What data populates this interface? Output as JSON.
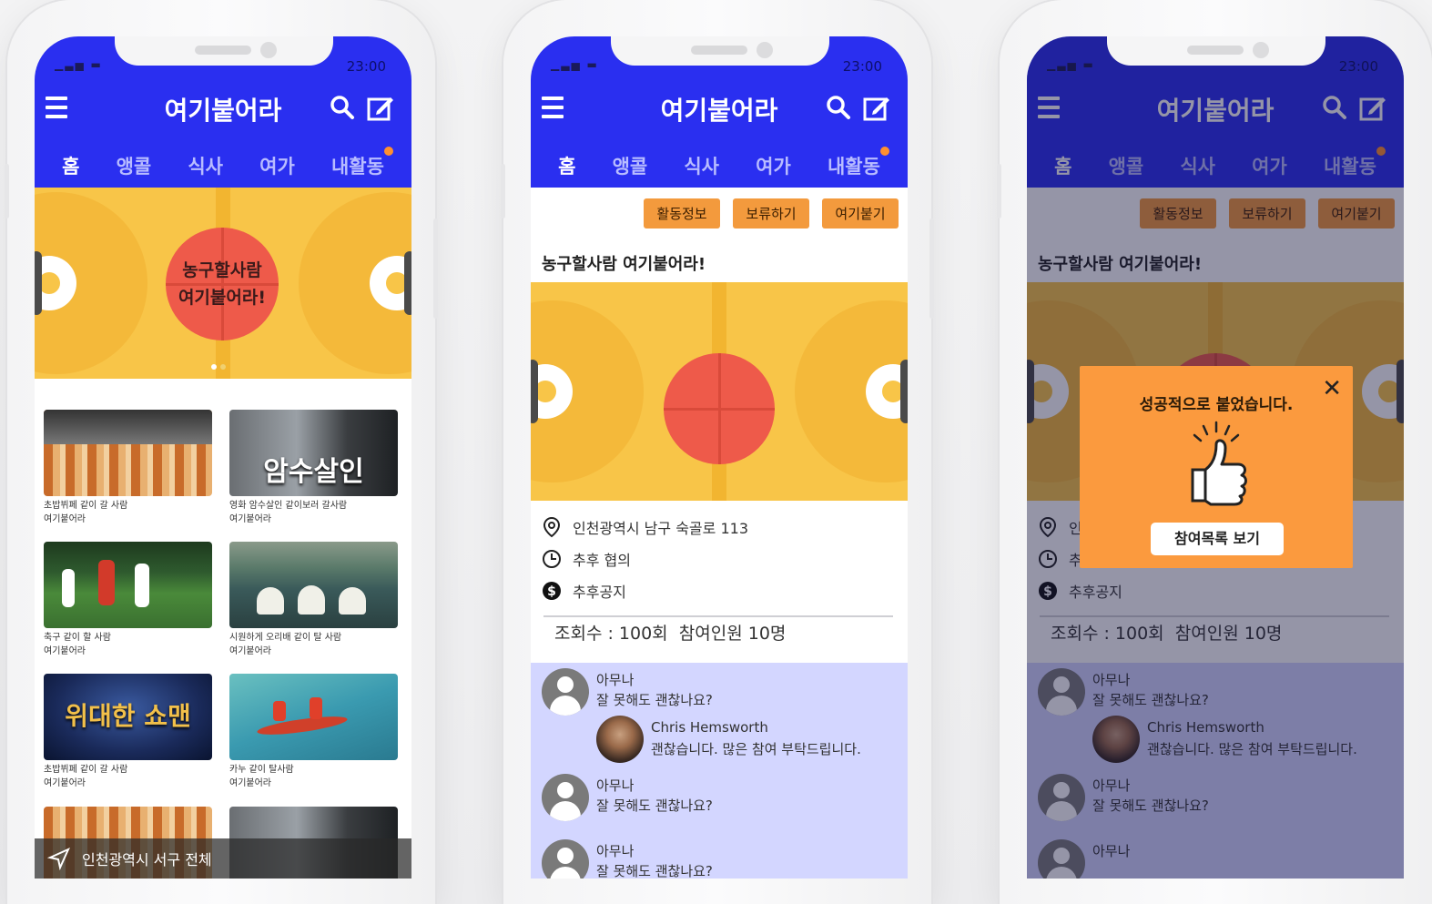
{
  "status_time": "23:00",
  "app_title": "여기붙어라",
  "tabs": [
    {
      "label": "홈"
    },
    {
      "label": "앵콜"
    },
    {
      "label": "식사"
    },
    {
      "label": "여가"
    },
    {
      "label": "내활동"
    }
  ],
  "home": {
    "banner_line1": "농구할사람",
    "banner_line2": "여기붙어라!",
    "cards": [
      {
        "title": "초밥뷔페 같이 갈 사람",
        "sub": "여기붙어라",
        "thumb": "sushi"
      },
      {
        "title": "영화 암수살인 같이보러 갈사람",
        "sub": "여기붙어라",
        "thumb": "movie",
        "overlay": "암수살인"
      },
      {
        "title": "축구 같이 할 사람",
        "sub": "여기붙어라",
        "thumb": "soccer"
      },
      {
        "title": "시원하게 오리배 같이 탈 사람",
        "sub": "여기붙어라",
        "thumb": "duckboat"
      },
      {
        "title": "초밥뷔페 같이 갈 사람",
        "sub": "여기붙어라",
        "thumb": "showman",
        "overlay": "위대한 쇼맨"
      },
      {
        "title": "카누 같이 탈사람",
        "sub": "여기붙어라",
        "thumb": "canoe"
      }
    ],
    "location": "인천광역시 서구 전체"
  },
  "detail": {
    "buttons": [
      "활동정보",
      "보류하기",
      "여기붙기"
    ],
    "title": "농구할사람 여기붙어라!",
    "address": "인천광역시 남구 숙골로 113",
    "time": "추후 협의",
    "cost": "추후공지",
    "views": "조회수 : 100회",
    "participants": "참여인원  10명",
    "comments": [
      {
        "name": "아무나",
        "text": "잘 못해도 괜찮나요?"
      },
      {
        "name": "Chris Hemsworth",
        "text": "괜찮습니다. 많은 참여 부탁드립니다."
      },
      {
        "name": "아무나",
        "text": "잘 못해도 괜찮나요?"
      },
      {
        "name": "아무나",
        "text": "잘 못해도 괜찮나요?"
      }
    ]
  },
  "popup": {
    "message": "성공적으로 붙었습니다.",
    "button": "참여목록 보기",
    "close": "✕",
    "partial_address": "인",
    "partial_time": "추"
  },
  "colors": {
    "primary": "#2a2ff0",
    "accent": "#f39a3d",
    "comment_bg": "#d3d6ff",
    "court": "#f8c548",
    "ball": "#ee5a4a"
  }
}
